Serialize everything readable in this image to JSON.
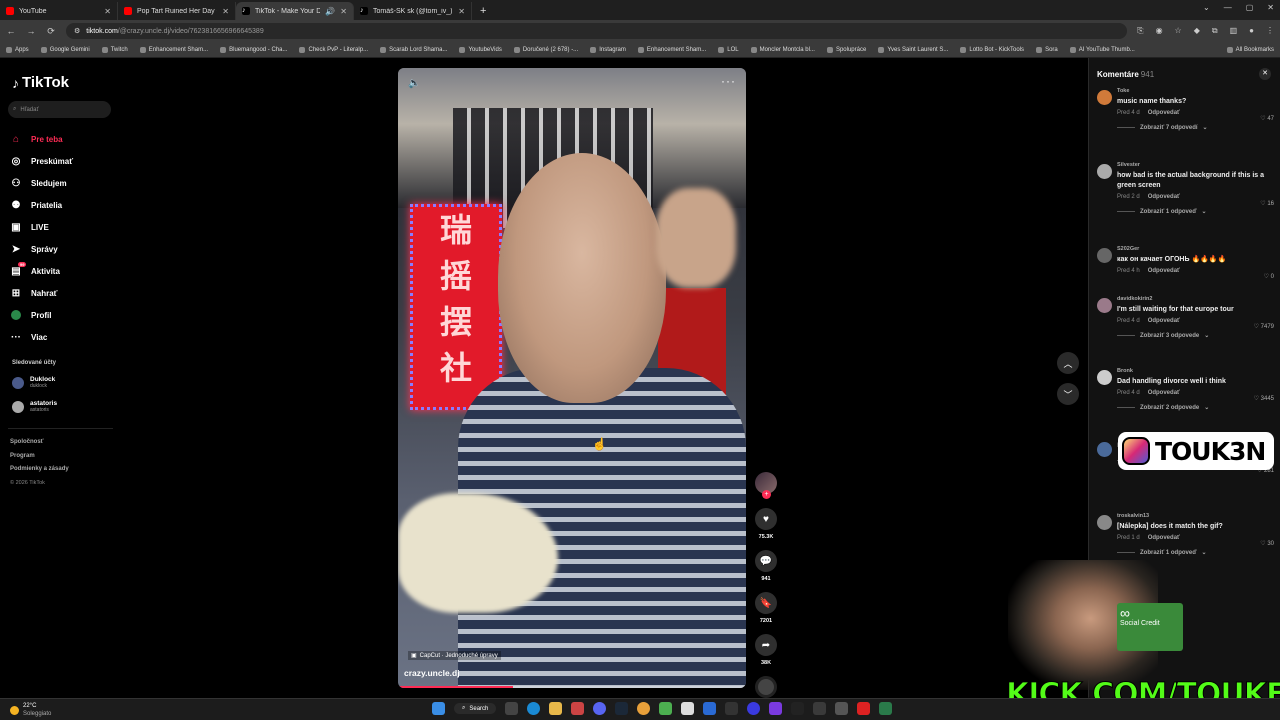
{
  "browser": {
    "tabs": [
      {
        "title": "YouTube",
        "color": "#ff0000"
      },
      {
        "title": "Pop Tart Ruined Her Day - YouT",
        "color": "#ff0000"
      },
      {
        "title": "TikTok - Make Your Day",
        "color": "#ffffff"
      },
      {
        "title": "Tomáš-SK sk (@tom_iv_) | TikTo",
        "color": "#ffffff"
      }
    ],
    "url_host": "tiktok.com",
    "url_path": "/@crazy.uncle.dj/video/7623816656966645389",
    "bookmarks": [
      "Apps",
      "Google Gemini",
      "Twitch",
      "Enhancement Sham...",
      "Bluemangood - Cha...",
      "Check PvP - Literalp...",
      "Scarab Lord Shama...",
      "YoutubeVids",
      "Doručené (2 678) -...",
      "Instagram",
      "Enhancement Sham...",
      "LOL",
      "Moncler Montcla bl...",
      "Spolupráce",
      "Yves Saint Laurent S...",
      "Lotto Bot - KickTools",
      "Sora",
      "AI YouTube Thumb..."
    ],
    "bookmarks_all": "All Bookmarks"
  },
  "sidebar": {
    "logo": "TikTok",
    "search_placeholder": "Hľadať",
    "nav": [
      {
        "label": "Pre teba",
        "icon": "home-icon",
        "active": true
      },
      {
        "label": "Preskúmať",
        "icon": "compass-icon"
      },
      {
        "label": "Sledujem",
        "icon": "following-icon"
      },
      {
        "label": "Priatelia",
        "icon": "friends-icon"
      },
      {
        "label": "LIVE",
        "icon": "live-icon"
      },
      {
        "label": "Správy",
        "icon": "messages-icon"
      },
      {
        "label": "Aktivita",
        "icon": "activity-icon",
        "badge": "99"
      },
      {
        "label": "Nahrať",
        "icon": "upload-icon"
      },
      {
        "label": "Profil",
        "icon": "profile-icon"
      },
      {
        "label": "Viac",
        "icon": "more-icon"
      }
    ],
    "following_title": "Sledované účty",
    "following": [
      {
        "name": "Duklock",
        "handle": "duklock"
      },
      {
        "name": "astatoris",
        "handle": "astatoris"
      }
    ],
    "footer": [
      "Spoločnosť",
      "Program",
      "Podmienky a zásady"
    ],
    "copyright": "© 2026 TikTok"
  },
  "video": {
    "author": "crazy.uncle.dj",
    "capcut": "CapCut · Jednoduché úpravy",
    "sign_chars": [
      "瑞",
      "摇",
      "摆",
      "社"
    ],
    "progress": 0.33
  },
  "actions": {
    "likes": "75.3K",
    "comments": "941",
    "saves": "7201",
    "shares": "38K"
  },
  "comments": {
    "title": "Komentáre",
    "count": "941",
    "items": [
      {
        "user": "Toke",
        "text": "music name thanks?",
        "time": "Pred 4 d",
        "reply": "Odpovedať",
        "likes": "47",
        "more": "Zobraziť 7 odpovedí"
      },
      {
        "user": "Silvester",
        "text": "how bad is the actual background if this is a green screen",
        "time": "Pred 2 d",
        "reply": "Odpovedať",
        "likes": "16",
        "more": "Zobraziť 1 odpoveď"
      },
      {
        "user": "S202Ger",
        "text": "как он качает ОГОНЬ 🔥🔥🔥🔥",
        "time": "Pred 4 h",
        "reply": "Odpovedať",
        "likes": "0",
        "more": ""
      },
      {
        "user": "davidkokirin2",
        "text": "I'm still waiting for that europe tour",
        "time": "Pred 4 d",
        "reply": "Odpovedať",
        "likes": "7479",
        "more": "Zobraziť 3 odpovede"
      },
      {
        "user": "Bronk",
        "text": "Dad handling divorce well i think",
        "time": "Pred 4 d",
        "reply": "Odpovedať",
        "likes": "3445",
        "more": "Zobraziť 2 odpovede"
      },
      {
        "user": "",
        "text": "",
        "time": "Pred 3 d",
        "reply": "Odpovedať",
        "likes": "281",
        "more": "Zobraziť 3 odpovede"
      },
      {
        "user": "troskalvin13",
        "text": "[Nálepka] does it match the gif?",
        "time": "Pred 1 d",
        "reply": "Odpovedať",
        "likes": "30",
        "more": "Zobraziť 1 odpoveď"
      }
    ]
  },
  "overlay": {
    "instagram_handle": "TOUK3N",
    "kick": "KICK.COM/TOUKEN",
    "social_credit": "Social Credit"
  },
  "taskbar": {
    "temp": "22°C",
    "weather": "Soleggiato",
    "search": "Search"
  }
}
